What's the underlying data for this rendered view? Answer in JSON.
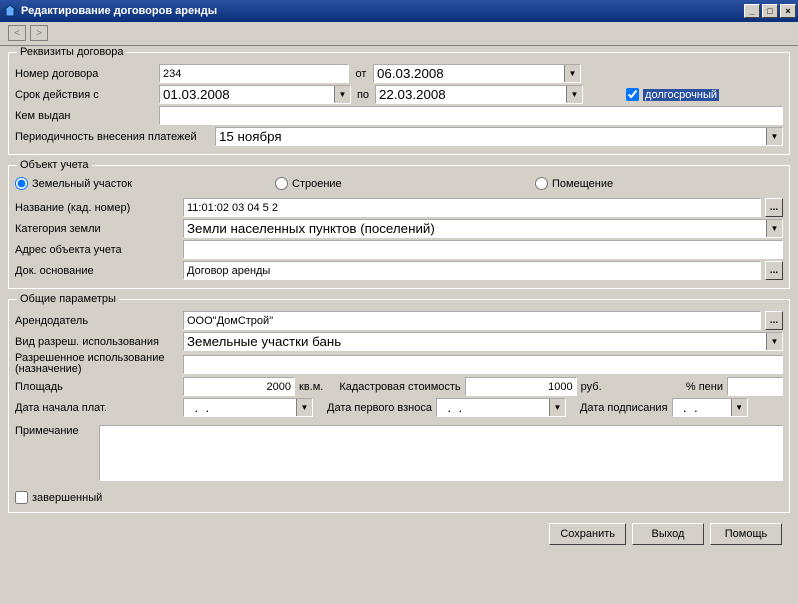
{
  "window": {
    "title": "Редактирование договоров аренды"
  },
  "nav": {
    "prev": "<",
    "next": ">"
  },
  "requisites": {
    "legend": "Реквизиты договора",
    "number_lbl": "Номер договора",
    "number_val": "234",
    "ot_lbl": "от",
    "ot_val": "06.03.2008",
    "srok_lbl": "Срок действия с",
    "srok_from": "01.03.2008",
    "po_lbl": "по",
    "srok_to": "22.03.2008",
    "longterm_lbl": "долгосрочный",
    "kem_lbl": "Кем выдан",
    "kem_val": "",
    "period_lbl": "Периодичность внесения платежей",
    "period_val": "15 ноября"
  },
  "object": {
    "legend": "Объект учета",
    "r1": "Земельный участок",
    "r2": "Строение",
    "r3": "Помещение",
    "name_lbl": "Название (кад. номер)",
    "name_val": "11:01:02 03 04 5 2",
    "cat_lbl": "Категория земли",
    "cat_val": "Земли населенных пунктов (поселений)",
    "addr_lbl": "Адрес объекта учета",
    "addr_val": "",
    "doc_lbl": "Док. основание",
    "doc_val": "Договор аренды"
  },
  "common": {
    "legend": "Общие параметры",
    "lessor_lbl": "Арендодатель",
    "lessor_val": "ООО\"ДомСтрой\"",
    "use_lbl": "Вид разреш. использования",
    "use_val": "Земельные участки бань",
    "perm_lbl": "Разрешенное использование (назначение)",
    "perm_val": "",
    "area_lbl": "Площадь",
    "area_val": "2000",
    "area_unit": "кв.м.",
    "cad_lbl": "Кадастровая стоимость",
    "cad_val": "1000",
    "cad_unit": "руб.",
    "peni_lbl": "% пени",
    "peni_val": "",
    "d1_lbl": "Дата начала плат.",
    "d1_val": "  .  .",
    "d2_lbl": "Дата первого взноса",
    "d2_val": "  .  .",
    "d3_lbl": "Дата подписания",
    "d3_val": "  .  .",
    "note_lbl": "Примечание",
    "note_val": ""
  },
  "footer": {
    "done_lbl": "завершенный",
    "save": "Сохранить",
    "exit": "Выход",
    "help": "Помощь"
  }
}
